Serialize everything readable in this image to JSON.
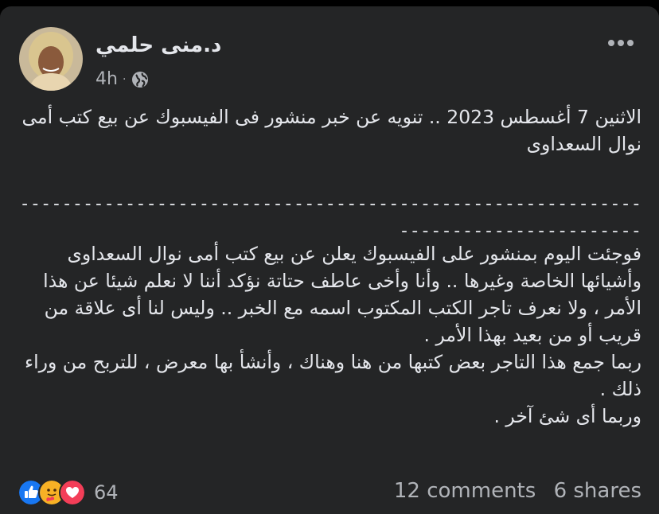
{
  "post": {
    "author": "د.منى حلمي",
    "time": "4h",
    "separator_dot": "·",
    "privacy_icon": "globe-icon",
    "more_icon": "more-horizontal-icon",
    "title_text": "الاثنين 7 أغسطس 2023 .. تنويه عن خبر منشور فى الفيسبوك عن بيع كتب أمى نوال السعداوى",
    "separator_line": "----------------------------------------------------------------------------------",
    "body_text": "فوجئت اليوم بمنشور على الفيسبوك يعلن عن بيع كتب أمى نوال السعداوى وأشيائها الخاصة وغيرها .. وأنا وأخى عاطف حتاتة نؤكد أننا لا نعلم شيئا عن هذا الأمر ، ولا نعرف تاجر الكتب المكتوب اسمه مع الخبر .. وليس لنا أى علاقة من قريب أو من بعيد بهذا الأمر .\nربما جمع هذا التاجر بعض كتبها من هنا وهناك ، وأنشأ بها معرض ، للتربح من وراء ذلك .\nوربما أى شئ آخر ."
  },
  "footer": {
    "reactions": [
      "like-icon",
      "care-icon",
      "love-icon"
    ],
    "reaction_count": "64",
    "comments": "12 comments",
    "shares": "6 shares"
  },
  "colors": {
    "background": "#242526",
    "text": "#e4e6eb",
    "secondary_text": "#b0b3b8",
    "like": "#1877f2",
    "love": "#f33e58",
    "care": "#f7b125"
  }
}
